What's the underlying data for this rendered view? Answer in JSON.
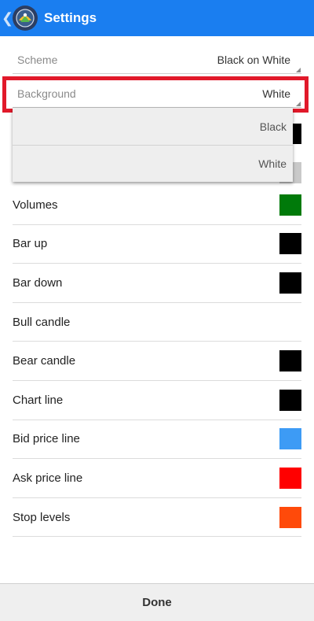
{
  "header": {
    "title": "Settings",
    "back_glyph": "❮",
    "logo_icon": "app-logo-icon"
  },
  "scheme": {
    "label": "Scheme",
    "value": "Black on White"
  },
  "background": {
    "label": "Background",
    "value": "White"
  },
  "dropdown": {
    "options": [
      "Black",
      "White"
    ]
  },
  "colors": {
    "appbar": "#1a7ef0",
    "highlight": "#e1192a"
  },
  "items": [
    {
      "label": "Volumes",
      "color": "#007a0a"
    },
    {
      "label": "Bar up",
      "color": "#000000"
    },
    {
      "label": "Bar down",
      "color": "#000000"
    },
    {
      "label": "Bull candle",
      "color": "#ffffff"
    },
    {
      "label": "Bear candle",
      "color": "#000000"
    },
    {
      "label": "Chart line",
      "color": "#000000"
    },
    {
      "label": "Bid price line",
      "color": "#3d9bf5"
    },
    {
      "label": "Ask price line",
      "color": "#ff0000"
    },
    {
      "label": "Stop levels",
      "color": "#ff4a0a"
    }
  ],
  "footer": {
    "done_label": "Done"
  }
}
